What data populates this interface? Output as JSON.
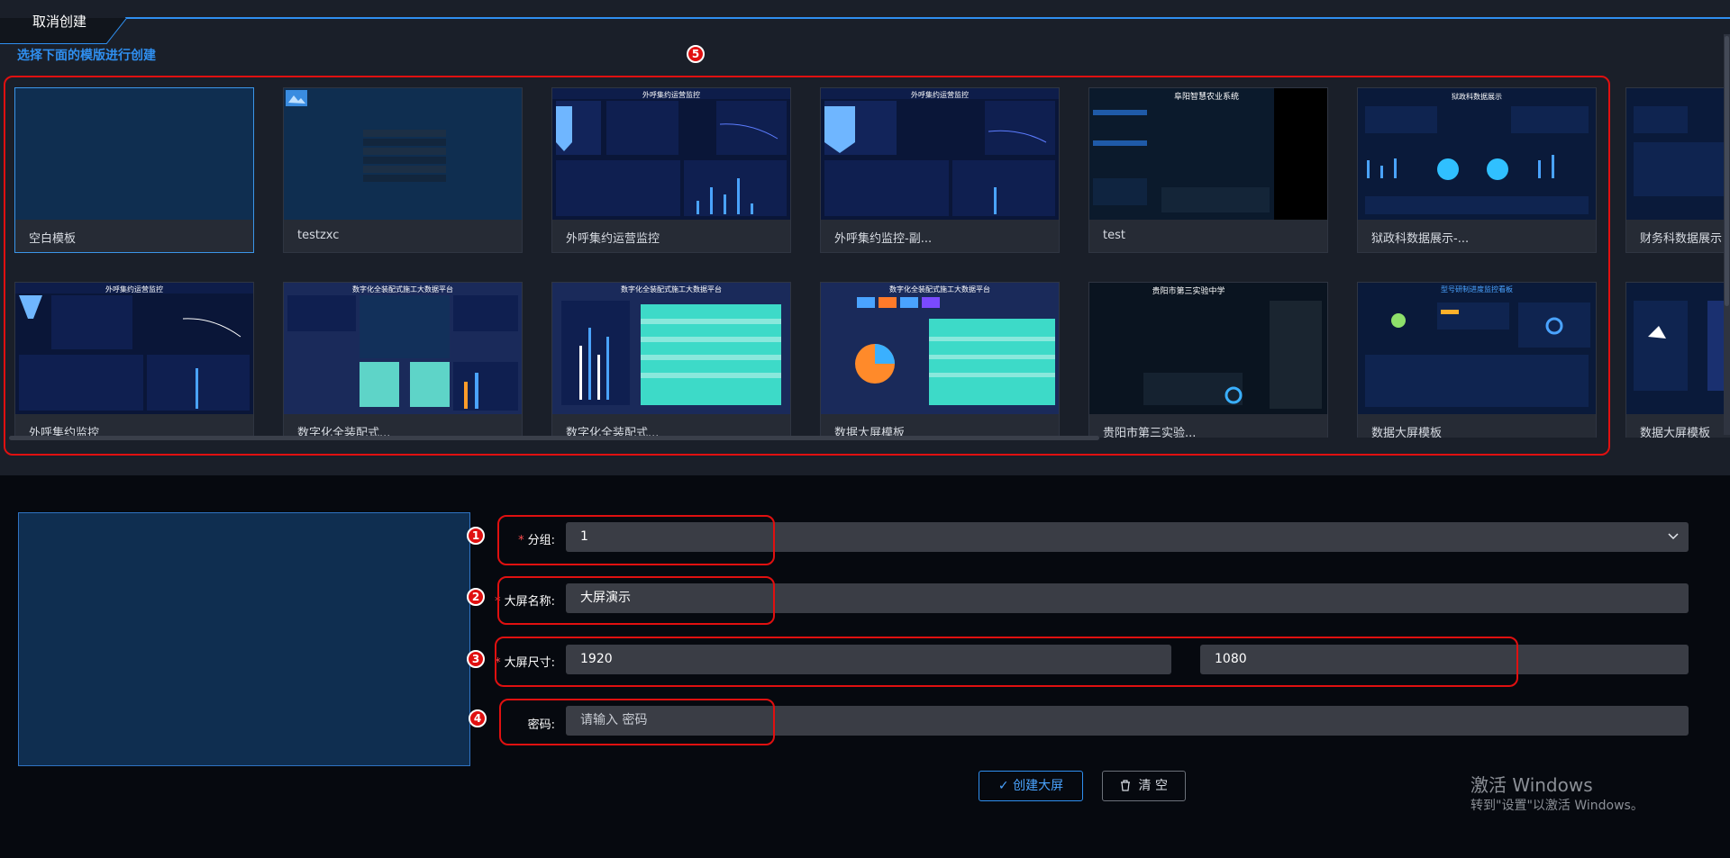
{
  "header": {
    "cancel_label": "取消创建",
    "subtitle": "选择下面的模版进行创建"
  },
  "templates": [
    {
      "label": "空白模板"
    },
    {
      "label": "testzxc"
    },
    {
      "label": "外呼集约运营监控",
      "thumb_title": "外呼集约运营监控"
    },
    {
      "label": "外呼集约监控-副...",
      "thumb_title": "外呼集约运营监控"
    },
    {
      "label": "test",
      "thumb_title": "阜阳智慧农业系统"
    },
    {
      "label": "狱政科数据展示-...",
      "thumb_title": "狱政科数据展示"
    },
    {
      "label": "财务科数据展示"
    },
    {
      "label": "外呼集约监控",
      "thumb_title": "外呼集约运营监控"
    },
    {
      "label": "数字化全装配式...",
      "thumb_title": "数字化全装配式施工大数据平台"
    },
    {
      "label": "数字化全装配式...",
      "thumb_title": "数字化全装配式施工大数据平台"
    },
    {
      "label": "数据大屏模板",
      "thumb_title": "数字化全装配式施工大数据平台"
    },
    {
      "label": "贵阳市第三实验...",
      "thumb_title": "贵阳市第三实验中学"
    },
    {
      "label": "数据大屏模板",
      "thumb_title": "型号研制进度监控看板"
    },
    {
      "label": "数据大屏模板"
    }
  ],
  "annotations": [
    "1",
    "2",
    "3",
    "4",
    "5"
  ],
  "form": {
    "group_label": "分组:",
    "group_value": "1",
    "name_label": "大屏名称:",
    "name_value": "大屏演示",
    "size_label": "大屏尺寸:",
    "width_value": "1920",
    "height_value": "1080",
    "password_label": "密码:",
    "password_placeholder": "请输入 密码",
    "required_mark": "*"
  },
  "buttons": {
    "create": "✓ 创建大屏",
    "clear": "清 空"
  },
  "watermark": {
    "line1": "激活 Windows",
    "line2": "转到\"设置\"以激活 Windows。"
  },
  "colors": {
    "accent": "#2f8ff0",
    "annotation": "#e01010",
    "panel": "#1a1f29",
    "card": "#262b35"
  }
}
